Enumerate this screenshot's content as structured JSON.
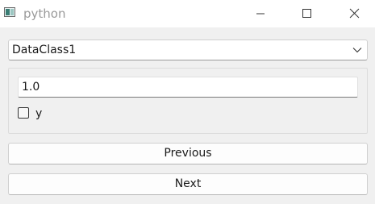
{
  "window": {
    "title": "python",
    "app_icon": "python-app-icon",
    "controls": {
      "minimize_icon": "minimize-icon",
      "maximize_icon": "maximize-icon",
      "close_icon": "close-icon"
    }
  },
  "form": {
    "class_selector": {
      "selected": "DataClass1",
      "arrow_icon": "chevron-down-icon"
    },
    "fields": {
      "x_value": "1.0",
      "y_label": "y",
      "y_checked": false
    }
  },
  "navigation": {
    "previous_label": "Previous",
    "next_label": "Next"
  },
  "colors": {
    "window_bg": "#f0f0f0",
    "titlebar_bg": "#ffffff",
    "title_text": "#9a9a9a"
  }
}
